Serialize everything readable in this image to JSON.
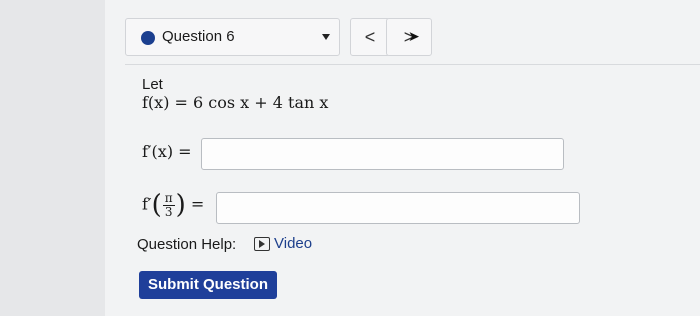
{
  "question_bar": {
    "label": "Question 6",
    "prev_symbol": "<",
    "next_symbol": ">"
  },
  "problem": {
    "intro": "Let",
    "function_def": "f(x) = 6 cos x + 4 tan x",
    "derivative_label": "f′(x) =",
    "eval_prefix": "f′",
    "eval_num": "π",
    "eval_den": "3",
    "eval_suffix": "=",
    "answer1_value": "",
    "answer2_value": ""
  },
  "help": {
    "label": "Question Help:",
    "video_label": "Video"
  },
  "submit_label": "Submit Question",
  "colors": {
    "accent": "#1f3f9a",
    "dot": "#1b3f8f"
  }
}
